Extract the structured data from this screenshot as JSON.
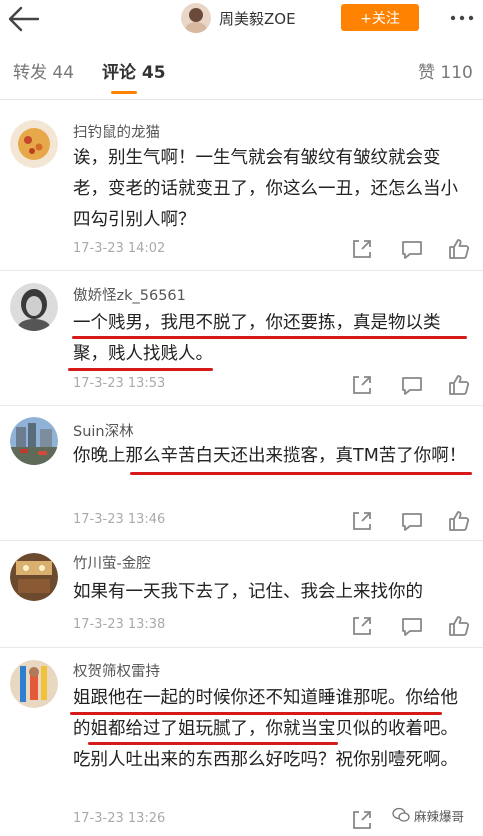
{
  "header": {
    "name": "周美毅ZOE",
    "follow_label": "+关注"
  },
  "tabs": [
    {
      "label": "转发 44"
    },
    {
      "label": "评论 45"
    },
    {
      "label": "赞 110"
    }
  ],
  "comments": [
    {
      "name": "扫钓鼠的龙猫",
      "text": "诶，别生气啊！一生气就会有皱纹有皱纹就会变老，变老的话就变丑了，你这么一丑，还怎么当小四勾引别人啊？",
      "time": "17-3-23 14:02"
    },
    {
      "name": "傲娇怪zk_56561",
      "text": "一个贱男，我甩不脱了，你还要拣，真是物以类聚，贱人找贱人。",
      "time": "17-3-23 13:53"
    },
    {
      "name": "Suin深林",
      "text": "你晚上那么辛苦白天还出来揽客，真TM苦了你啊！",
      "time": "17-3-23 13:46"
    },
    {
      "name": "竹川萤-金腔",
      "text": "如果有一天我下去了，记住、我会上来找你的",
      "time": "17-3-23 13:38"
    },
    {
      "name": "权贺筛权雷持",
      "text": "姐跟他在一起的时候你还不知道睡谁那呢。你给他的姐都给过了姐玩腻了，你就当宝贝似的收着吧。吃别人吐出来的东西那么好吃吗？祝你别噎死啊。",
      "time": "17-3-23 13:26"
    }
  ],
  "watermark": "麻辣爆哥",
  "colors": {
    "accent": "#ff8200",
    "underline_red": "#d61a1a"
  }
}
